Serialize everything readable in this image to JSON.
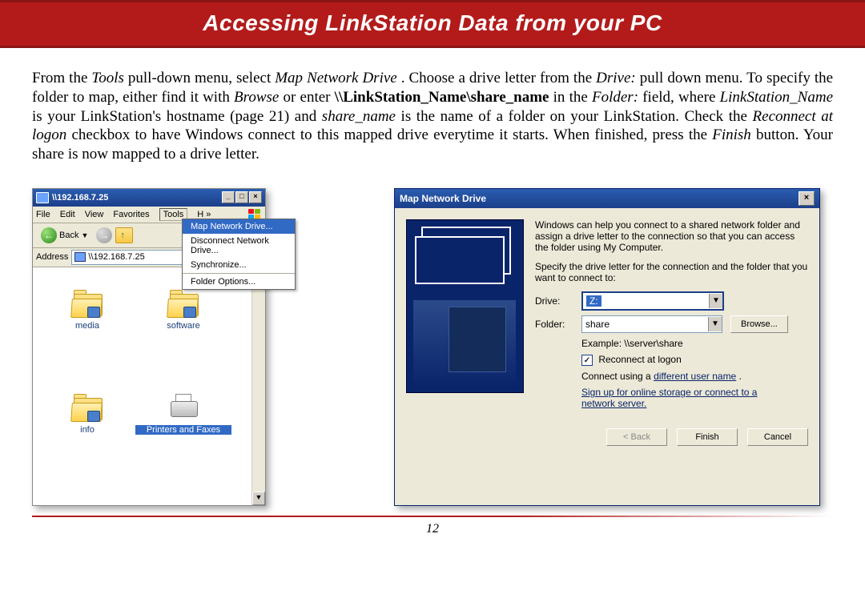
{
  "header": {
    "title": "Accessing LinkStation Data from your PC"
  },
  "paragraph": {
    "p1a": "From the ",
    "tools": "Tools",
    "p1b": " pull-down menu, select ",
    "mapnd": "Map Network Drive",
    "p1c": ".  Choose a drive letter from the ",
    "drive": "Drive:",
    "p2a": " pull down menu.  To specify the folder to map, either find it with ",
    "browse": "Browse",
    "p2b": " or enter ",
    "lspath": "\\\\LinkStation_Name\\share_name",
    "p2c": " in the ",
    "folder": "Folder:",
    "p2d": " field, where ",
    "lsname": "LinkStation_Name",
    "p2e": " is your LinkStation's hostname (page 21) and ",
    "sharename": "share_name",
    "p2f": " is the name of a folder on your LinkStation.  Check the ",
    "reconnect": "Reconnect at logon",
    "p2g": " checkbox to have Windows connect to this mapped drive everytime it starts.  When finished, press the ",
    "finish": "Finish",
    "p2h": " button.  Your share is now mapped to a drive letter."
  },
  "explorer": {
    "title": "\\\\192.168.7.25",
    "menubar": {
      "file": "File",
      "edit": "Edit",
      "view": "View",
      "favorites": "Favorites",
      "tools": "Tools",
      "more": "H »"
    },
    "toolbar": {
      "back": "Back"
    },
    "addressLabel": "Address",
    "addressValue": "\\\\192.168.7.25",
    "toolsMenu": {
      "map": "Map Network Drive...",
      "disconnect": "Disconnect Network Drive...",
      "sync": "Synchronize...",
      "folderOptions": "Folder Options..."
    },
    "folders": {
      "media": "media",
      "software": "software",
      "info": "info",
      "printers": "Printers and Faxes"
    }
  },
  "mapdlg": {
    "title": "Map Network Drive",
    "intro1": "Windows can help you connect to a shared network folder and assign a drive letter to the connection so that you can access the folder using My Computer.",
    "intro2": "Specify the drive letter for the connection and the folder that you want to connect to:",
    "driveLabel": "Drive:",
    "driveValue": "Z:",
    "folderLabel": "Folder:",
    "folderValue": "share",
    "browse": "Browse...",
    "example": "Example: \\\\server\\share",
    "reconnect": "Reconnect at logon",
    "connectUsing_a": "Connect using a ",
    "connectUsing_link": "different user name",
    "connectUsing_b": ".",
    "signup": "Sign up for online storage or connect to a network server.",
    "back": "< Back",
    "finish": "Finish",
    "cancel": "Cancel"
  },
  "page_number": "12"
}
